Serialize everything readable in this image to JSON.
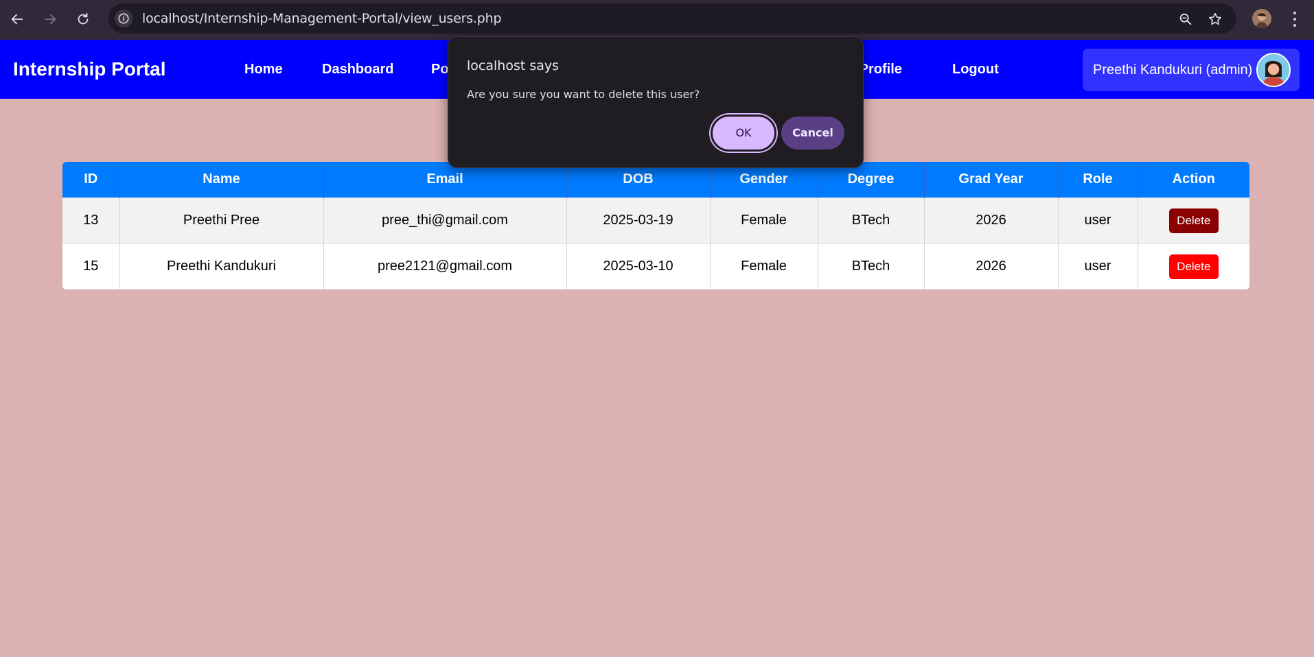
{
  "browser": {
    "url": "localhost/Internship-Management-Portal/view_users.php"
  },
  "navbar": {
    "brand": "Internship Portal",
    "links": [
      "Home",
      "Dashboard",
      "Po",
      "e Profile",
      "Logout"
    ],
    "user_label": "Preethi Kandukuri (admin)"
  },
  "table": {
    "headers": [
      "ID",
      "Name",
      "Email",
      "DOB",
      "Gender",
      "Degree",
      "Grad Year",
      "Role",
      "Action"
    ],
    "rows": [
      {
        "id": "13",
        "name": "Preethi Pree",
        "email": "pree_thi@gmail.com",
        "dob": "2025-03-19",
        "gender": "Female",
        "degree": "BTech",
        "grad_year": "2026",
        "role": "user",
        "action": "Delete"
      },
      {
        "id": "15",
        "name": "Preethi Kandukuri",
        "email": "pree2121@gmail.com",
        "dob": "2025-03-10",
        "gender": "Female",
        "degree": "BTech",
        "grad_year": "2026",
        "role": "user",
        "action": "Delete"
      }
    ]
  },
  "dialog": {
    "title": "localhost says",
    "message": "Are you sure you want to delete this user?",
    "ok_label": "OK",
    "cancel_label": "Cancel"
  },
  "colors": {
    "page_bg": "#dbb1b1",
    "navbar_bg": "#0000ff",
    "table_header_bg": "#007bff",
    "delete_button": "#ff0000",
    "delete_button_hover": "#8b0000"
  }
}
